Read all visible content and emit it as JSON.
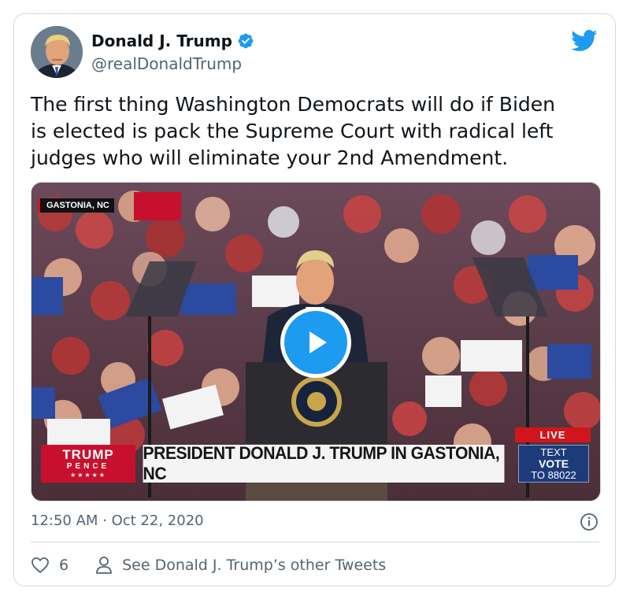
{
  "author": {
    "name": "Donald J. Trump",
    "handle": "@realDonaldTrump",
    "verified": true,
    "avatar_icon": "avatar-photo"
  },
  "tweet": {
    "lines": [
      "The first thing Washington Democrats will do if Biden",
      "is elected is pack the Supreme Court with radical left",
      "judges who will eliminate your 2nd Amendment."
    ]
  },
  "media": {
    "location_tag": "GASTONIA, NC",
    "chyron": "PRESIDENT DONALD J. TRUMP IN GASTONIA, NC",
    "logo_trump": "TRUMP",
    "logo_pence": "PENCE",
    "logo_stars": "★★★★★",
    "live_label": "LIVE",
    "text_line1": "TEXT",
    "text_line2": "VOTE",
    "text_line3": "TO 88022",
    "play_icon": "play-icon"
  },
  "meta": {
    "timestamp": "12:50 AM · Oct 22, 2020",
    "info_icon": "info-icon"
  },
  "footer": {
    "like_count": "6",
    "other_tweets": "See Donald J. Trump’s other Tweets"
  },
  "colors": {
    "twitter_blue": "#1d9bf0",
    "text_primary": "#0f1419",
    "text_secondary": "#536471",
    "border": "#cfd9de",
    "trump_red": "#c8102e",
    "vote_blue": "#1d3a7a"
  }
}
